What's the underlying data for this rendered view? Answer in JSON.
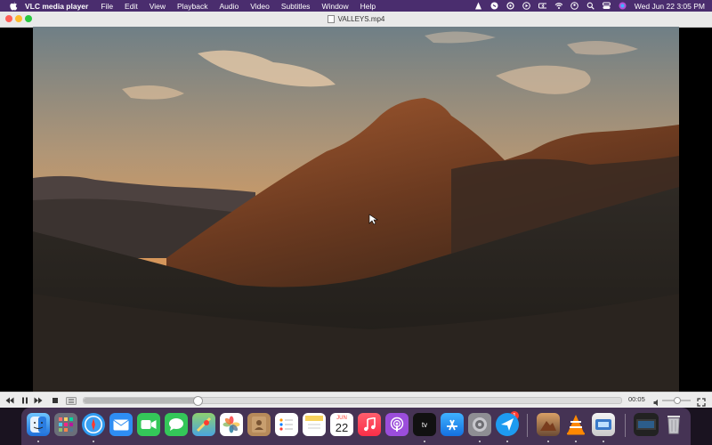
{
  "menubar": {
    "app_name": "VLC media player",
    "menus": [
      "File",
      "Edit",
      "View",
      "Playback",
      "Audio",
      "Video",
      "Subtitles",
      "Window",
      "Help"
    ],
    "clock": "Wed Jun 22  3:05 PM"
  },
  "window": {
    "title": "VALLEYS.mp4"
  },
  "player": {
    "elapsed": "00:05",
    "progress_fraction": 0.21,
    "volume_fraction": 0.5
  },
  "dock": {
    "calendar_month": "JUN",
    "calendar_day": "22",
    "settings_badge": "1"
  },
  "colors": {
    "menubar": "#4a2d6e",
    "dock": "#4e3a5e",
    "titlebar": "#e9e9e9"
  }
}
